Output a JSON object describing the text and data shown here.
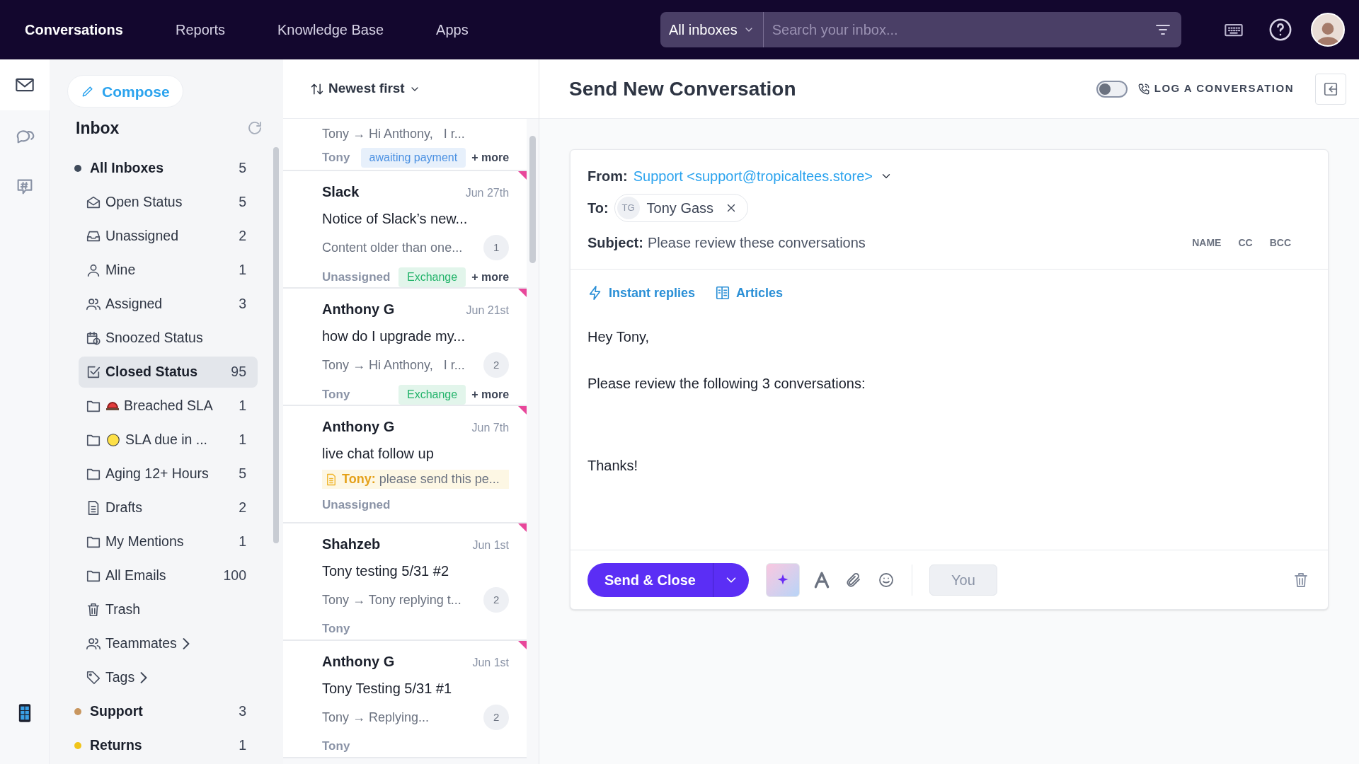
{
  "top_nav": {
    "tabs": [
      {
        "label": "Conversations",
        "selected": true
      },
      {
        "label": "Reports",
        "selected": false
      },
      {
        "label": "Knowledge Base",
        "selected": false
      },
      {
        "label": "Apps",
        "selected": false
      }
    ],
    "search": {
      "scope": "All inboxes",
      "placeholder": "Search your inbox..."
    }
  },
  "rail": [
    {
      "kind": "mail",
      "selected": true
    },
    {
      "kind": "chat",
      "selected": false
    },
    {
      "kind": "hash",
      "selected": false
    },
    {
      "kind": "phone",
      "selected": false
    }
  ],
  "sidebar": {
    "compose": "Compose",
    "title": "Inbox",
    "items": [
      {
        "label": "All Inboxes",
        "count": "5",
        "color": "#3f4a5a",
        "selected": false,
        "children": [
          {
            "label": "Open Status",
            "count": "5",
            "kind": "status",
            "selected": false
          },
          {
            "label": "Unassigned",
            "count": "2",
            "kind": "unassigned",
            "selected": false
          },
          {
            "label": "Mine",
            "count": "1",
            "kind": "mine",
            "selected": false
          },
          {
            "label": "Assigned",
            "count": "3",
            "kind": "team",
            "selected": false
          },
          {
            "label": "Snoozed Status",
            "kind": "snoozed",
            "selected": false
          },
          {
            "label": "Closed Status",
            "count": "95",
            "kind": "closed",
            "selected": true
          },
          {
            "label": "Breached SLA",
            "count": "1",
            "kind": "folder-siren",
            "selected": false
          },
          {
            "label": "SLA due in ...",
            "count": "1",
            "kind": "folder-circle",
            "selected": false
          },
          {
            "label": "Aging 12+ Hours",
            "count": "5",
            "kind": "folder",
            "selected": false
          },
          {
            "label": "Drafts",
            "count": "2",
            "kind": "drafts",
            "selected": false
          },
          {
            "label": "My Mentions",
            "count": "1",
            "kind": "folder",
            "selected": false
          },
          {
            "label": "All Emails",
            "count": "100",
            "kind": "folder",
            "selected": false
          },
          {
            "label": "Trash",
            "kind": "trash",
            "selected": false
          },
          {
            "label": "Teammates",
            "kind": "team",
            "expanded": false,
            "selected": false
          },
          {
            "label": "Tags",
            "kind": "tags",
            "expanded": false,
            "selected": false
          }
        ]
      },
      {
        "label": "Support",
        "count": "3",
        "color": "#c8965f",
        "selected": false
      },
      {
        "label": "Returns",
        "count": "1",
        "color": "#f0c419",
        "selected": false
      }
    ]
  },
  "conversation_list": {
    "sort": "Newest first",
    "items": [
      {
        "kind": "partial",
        "preview": "Tony → Hi Anthony,   I r...",
        "assignee": "Tony",
        "tag": {
          "label": "awaiting payment",
          "color": "#4a90e2"
        },
        "more": "+ more",
        "unread": false
      },
      {
        "kind": "message",
        "sender": "Slack",
        "date": "Jun 27th",
        "subject": "Notice of Slack’s new...",
        "preview": "Content older than one...",
        "count": "1",
        "assignee": "Unassigned",
        "tag": {
          "label": "Exchange",
          "color": "#22b36a"
        },
        "more": "+ more",
        "unread": true
      },
      {
        "kind": "message",
        "sender": "Anthony G",
        "date": "Jun 21st",
        "subject": "how do I upgrade my...",
        "preview": "Tony → Hi Anthony,   I r...",
        "count": "2",
        "assignee": "Tony",
        "tag": {
          "label": "Exchange",
          "color": "#22b36a"
        },
        "more": "+ more",
        "unread": true
      },
      {
        "kind": "note",
        "sender": "Anthony G",
        "date": "Jun 7th",
        "subject": "live chat follow up",
        "preview": "**Tony:** please send this pe...",
        "assignee": "Unassigned",
        "unread": true
      },
      {
        "kind": "message",
        "sender": "Shahzeb",
        "date": "Jun 1st",
        "subject": "Tony testing 5/31 #2",
        "preview": "Tony → Tony replying t...",
        "count": "2",
        "assignee": "Tony",
        "unread": true
      },
      {
        "kind": "message",
        "sender": "Anthony G",
        "date": "Jun 1st",
        "subject": "Tony Testing 5/31 #1",
        "preview": "Tony → Replying...",
        "count": "2",
        "assignee": "Tony",
        "unread": true
      }
    ]
  },
  "composer": {
    "title": "Send New Conversation",
    "log_toggle": {
      "on": false
    },
    "log_label": "LOG A CONVERSATION",
    "from_label": "From:",
    "from_value": "Support <support@tropicaltees.store>",
    "to_label": "To:",
    "recipient": {
      "initials": "TG",
      "name": "Tony Gass"
    },
    "subject_label": "Subject:",
    "subject_value": "Please review these conversations",
    "field_toggles": [
      "NAME",
      "CC",
      "BCC"
    ],
    "links": [
      {
        "kind": "bolt",
        "label": "Instant replies"
      },
      {
        "kind": "book",
        "label": "Articles"
      }
    ],
    "body": {
      "greeting": "Hey Tony,",
      "message": "Please review the following 3 conversations:",
      "signoff": "Thanks!"
    },
    "send_label": "Send & Close",
    "assignee_button": "You"
  }
}
